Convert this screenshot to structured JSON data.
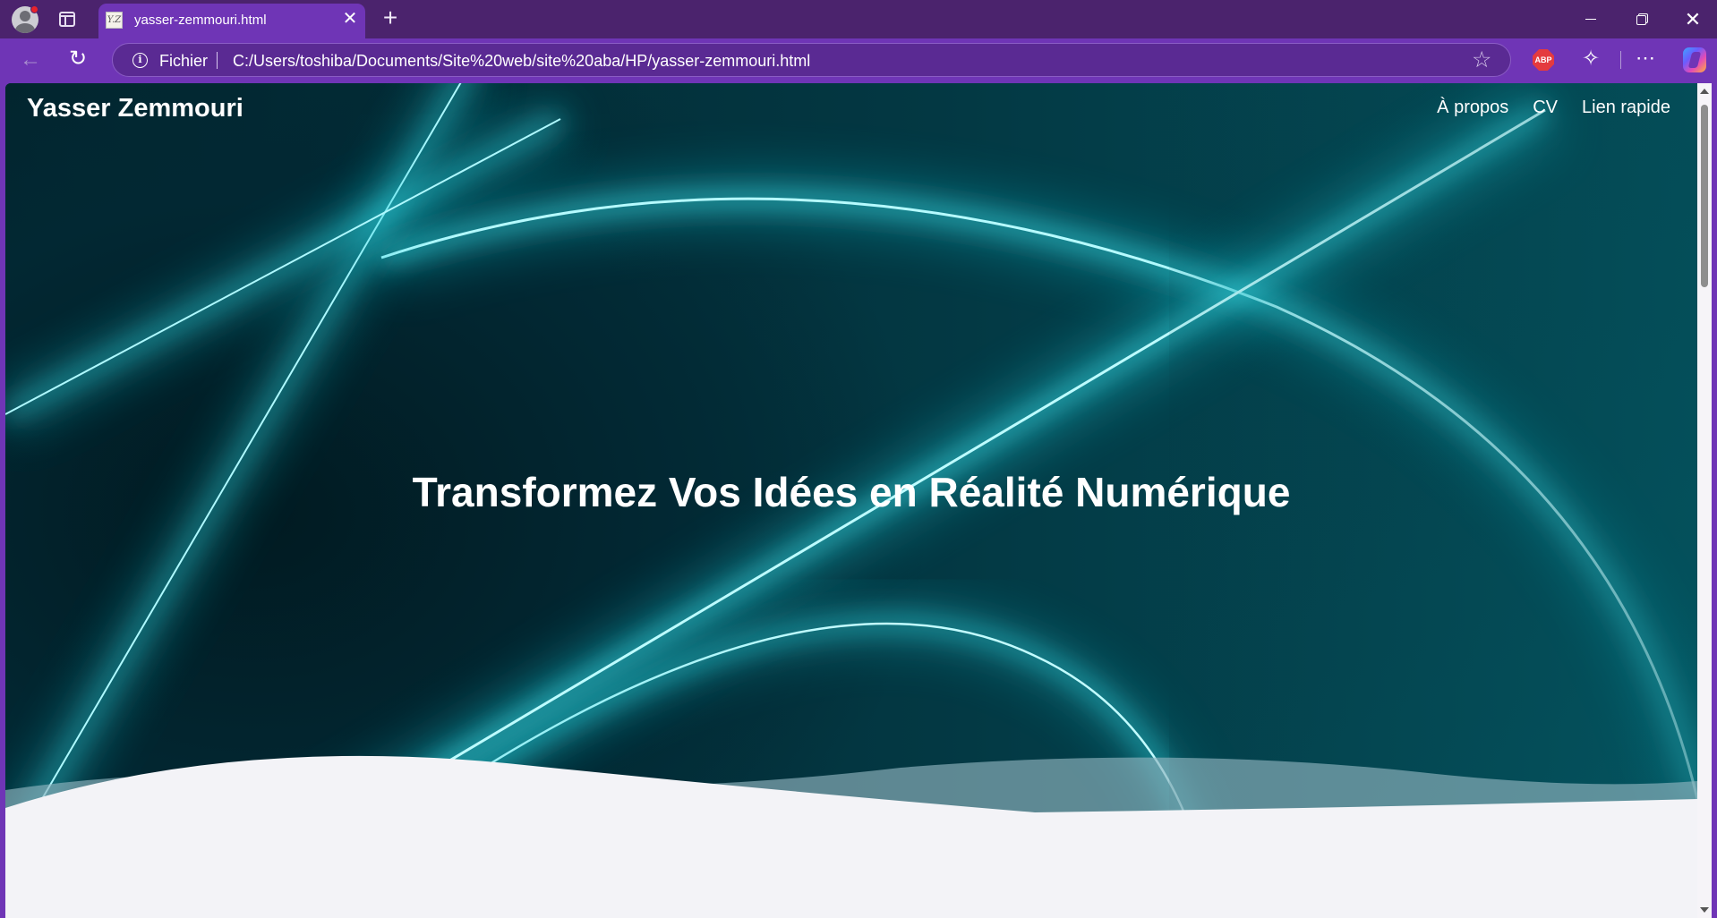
{
  "browser": {
    "tab": {
      "favicon_text": "Y.Z",
      "title": "yasser-zemmouri.html",
      "close_glyph": "✕"
    },
    "new_tab_glyph": "+",
    "window_close_glyph": "✕",
    "address_bar": {
      "info_glyph": "i",
      "scheme_label": "Fichier",
      "url": "C:/Users/toshiba/Documents/Site%20web/site%20aba/HP/yasser-zemmouri.html"
    },
    "toolbar": {
      "back_glyph": "←",
      "refresh_glyph": "↻",
      "star_glyph": "☆",
      "abp_label": "ABP",
      "extensions_glyph": "✧",
      "more_glyph": "⋯"
    },
    "colors": {
      "titlebar": "#4b236d",
      "toolbar": "#6f35b6",
      "accent_cyan": "#3fe6f0"
    }
  },
  "site": {
    "logo": "Yasser Zemmouri",
    "nav": [
      {
        "label": "À propos"
      },
      {
        "label": "CV"
      },
      {
        "label": "Lien rapide"
      }
    ],
    "hero_title": "Transformez Vos Idées en Réalité Numérique"
  }
}
